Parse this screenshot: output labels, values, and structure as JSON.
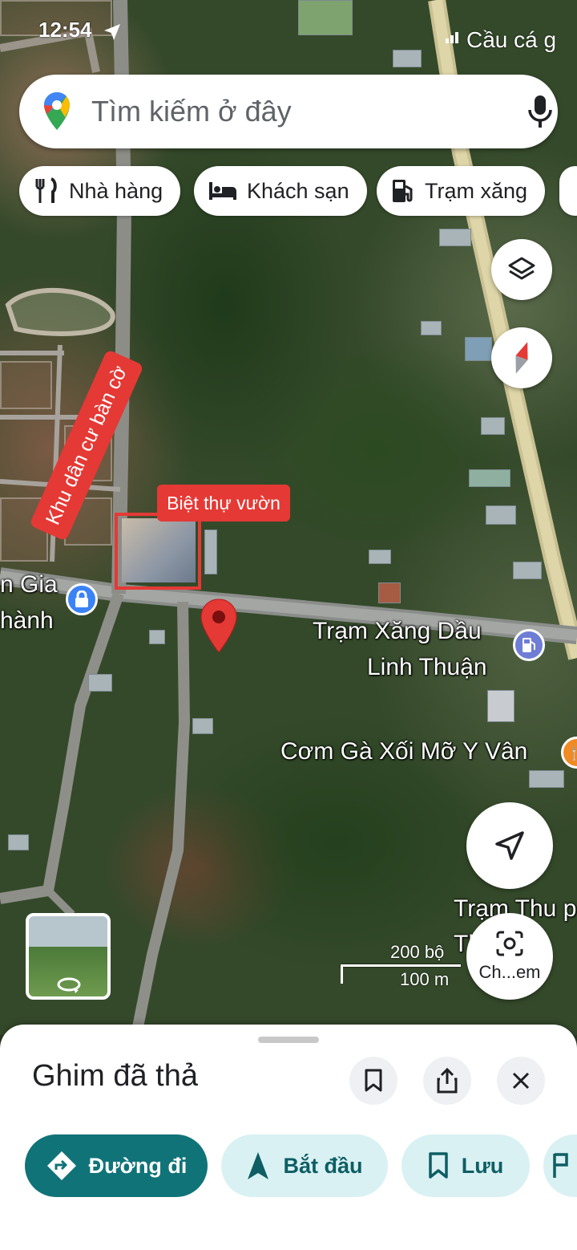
{
  "status_bar": {
    "time": "12:54",
    "back_app": "Cầu cá g"
  },
  "search": {
    "placeholder": "Tìm kiếm ở đây"
  },
  "chips": [
    {
      "label": "Nhà hàng",
      "icon": "restaurant-icon"
    },
    {
      "label": "Khách sạn",
      "icon": "hotel-icon"
    },
    {
      "label": "Trạm xăng",
      "icon": "gas-station-icon"
    }
  ],
  "map": {
    "labels": {
      "area_banner": "Khu dân cư bàn cờ",
      "villa_tag": "Biệt thự vườn",
      "left_place_line1": "n Gia",
      "left_place_line2": "hành",
      "gas_station_line1": "Trạm Xăng Dầu",
      "gas_station_line2": "Linh Thuận",
      "restaurant": "Cơm Gà Xối Mỡ Y Vân",
      "toll_line1": "Trạm Thu p",
      "toll_line2": "Th   ươ"
    },
    "scale": {
      "imperial": "200 bộ",
      "metric": "100 m"
    },
    "lens_label": "Ch...em",
    "colors": {
      "pin": "#e53935",
      "villa_tag": "#e53935",
      "gas_poi": "#6f7dd6",
      "lock_poi": "#3b82f6"
    }
  },
  "sheet": {
    "title": "Ghim đã thả",
    "actions": [
      {
        "label": "Đường đi",
        "icon": "directions-icon",
        "primary": true
      },
      {
        "label": "Bắt đầu",
        "icon": "navigation-arrow-icon"
      },
      {
        "label": "Lưu",
        "icon": "bookmark-icon"
      }
    ]
  }
}
